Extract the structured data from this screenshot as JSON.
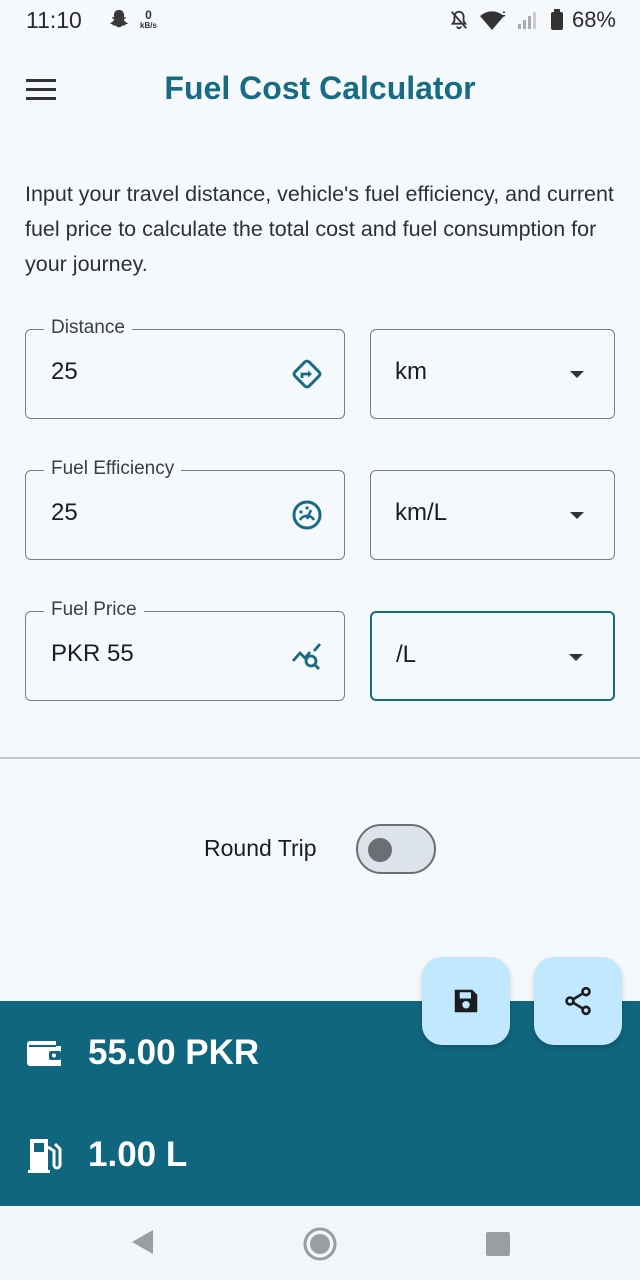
{
  "status_bar": {
    "time": "11:10",
    "net_speed_value": "0",
    "net_speed_unit": "kB/s",
    "battery": "68%"
  },
  "app_bar": {
    "title": "Fuel Cost Calculator",
    "menu_icon": "hamburger-menu-icon"
  },
  "intro_text": "Input your travel distance, vehicle's fuel efficiency, and current fuel price to calculate the total cost and fuel consumption for your journey.",
  "fields": {
    "distance": {
      "label": "Distance",
      "value": "25",
      "icon": "directions-icon",
      "unit": "km"
    },
    "efficiency": {
      "label": "Fuel Efficiency",
      "value": "25",
      "icon": "speedometer-icon",
      "unit": "km/L"
    },
    "price": {
      "label": "Fuel Price",
      "value": "PKR 55",
      "icon": "price-trend-search-icon",
      "unit": "/L"
    }
  },
  "round_trip": {
    "label": "Round Trip",
    "enabled": false
  },
  "actions": {
    "save_icon": "save-icon",
    "share_icon": "share-icon"
  },
  "results": {
    "total_cost": "55.00 PKR",
    "fuel_used": "1.00 L"
  },
  "colors": {
    "primary": "#176c83",
    "result_panel": "#11667f",
    "fab_background": "#c2e8ff",
    "background": "#f6f9fc"
  }
}
